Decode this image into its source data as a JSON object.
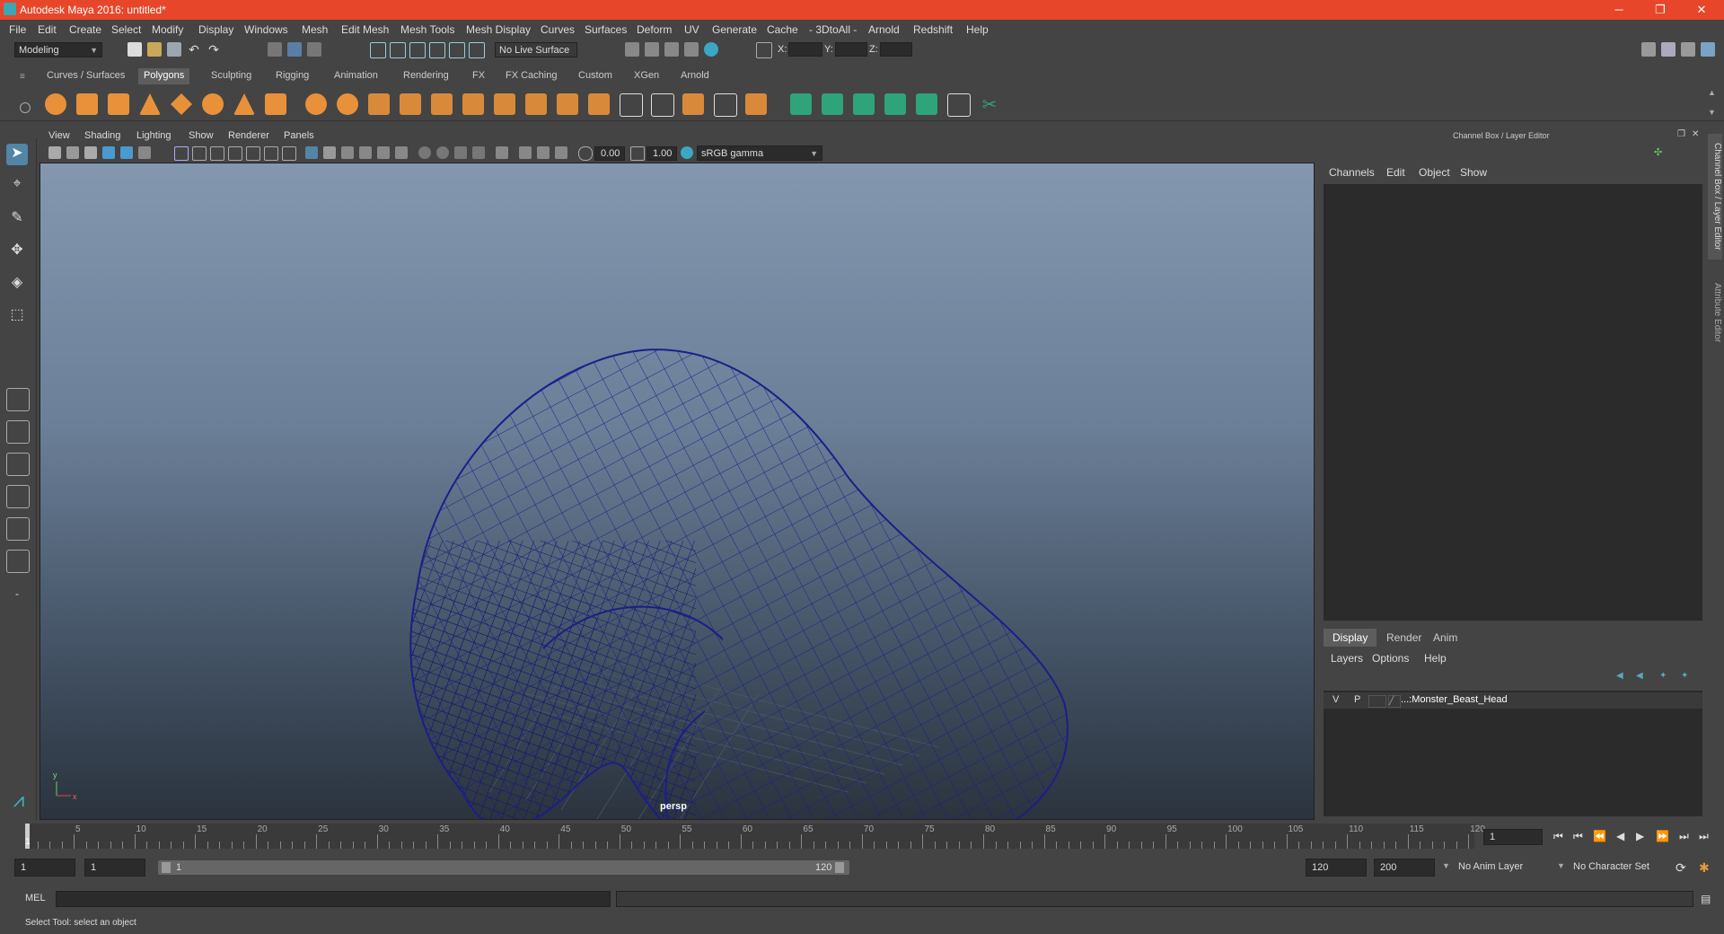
{
  "window": {
    "title": "Autodesk Maya 2016: untitled*",
    "minimize": "─",
    "restore": "❐",
    "close": "✕"
  },
  "menubar": [
    "File",
    "Edit",
    "Create",
    "Select",
    "Modify",
    "Display",
    "Windows",
    "Mesh",
    "Edit Mesh",
    "Mesh Tools",
    "Mesh Display",
    "Curves",
    "Surfaces",
    "Deform",
    "UV",
    "Generate",
    "Cache",
    "- 3DtoAll -",
    "Arnold",
    "Redshift",
    "Help"
  ],
  "statusline": {
    "menuset": "Modeling",
    "live_surface": "No Live Surface",
    "x_label": "X:",
    "y_label": "Y:",
    "z_label": "Z:"
  },
  "shelf": {
    "tabs": [
      "Curves / Surfaces",
      "Polygons",
      "Sculpting",
      "Rigging",
      "Animation",
      "Rendering",
      "FX",
      "FX Caching",
      "Custom",
      "XGen",
      "Arnold"
    ],
    "active_tab": "Polygons"
  },
  "viewport": {
    "menu": [
      "View",
      "Shading",
      "Lighting",
      "Show",
      "Renderer",
      "Panels"
    ],
    "near_value": "0.00",
    "far_value": "1.00",
    "color_space": "sRGB gamma",
    "camera_label": "persp",
    "axis_y": "y",
    "axis_x": "x"
  },
  "channelbox": {
    "title": "Channel Box / Layer Editor",
    "menu": [
      "Channels",
      "Edit",
      "Object",
      "Show"
    ]
  },
  "layereditor": {
    "tabs": [
      "Display",
      "Render",
      "Anim"
    ],
    "active_tab": "Display",
    "menu": [
      "Layers",
      "Options",
      "Help"
    ],
    "layer": {
      "v": "V",
      "p": "P",
      "name": "...:Monster_Beast_Head"
    }
  },
  "sidetabs": [
    "Channel Box / Layer Editor",
    "Attribute Editor"
  ],
  "timeslider": {
    "ticks": [
      "5",
      "10",
      "15",
      "20",
      "25",
      "30",
      "35",
      "40",
      "45",
      "50",
      "55",
      "60",
      "65",
      "70",
      "75",
      "80",
      "85",
      "90",
      "95",
      "100",
      "105",
      "110",
      "115",
      "120"
    ],
    "current_frame_marker": "1",
    "current_frame": "1"
  },
  "range": {
    "start": "1",
    "anim_start": "1",
    "range_start_label": "1",
    "range_end_label": "120",
    "anim_end": "120",
    "end": "200",
    "anim_layer": "No Anim Layer",
    "character_set": "No Character Set"
  },
  "cmdline": {
    "label": "MEL"
  },
  "helpline": {
    "text": "Select Tool: select an object"
  },
  "colors": {
    "titlebar": "#e8462a",
    "wire": "#1a1f8a",
    "panel": "#444444"
  }
}
